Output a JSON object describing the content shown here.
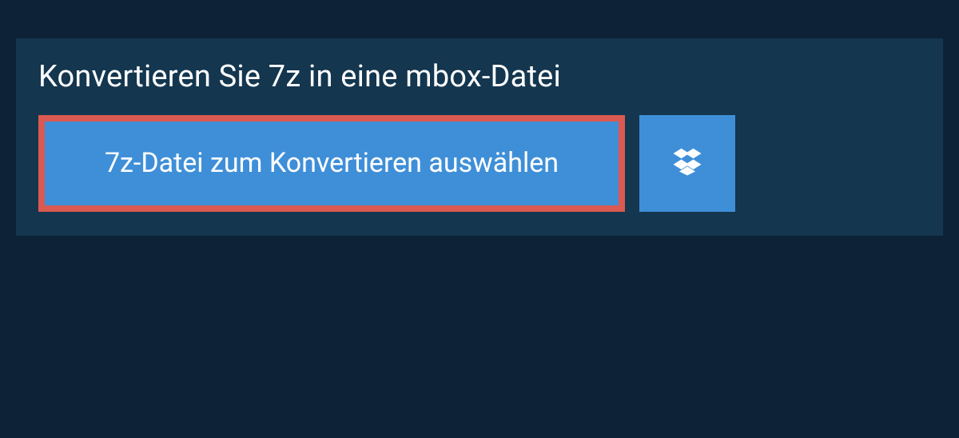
{
  "panel": {
    "title": "Konvertieren Sie 7z in eine mbox-Datei",
    "select_button_label": "7z-Datei zum Konvertieren auswählen"
  },
  "colors": {
    "page_bg": "#0d2236",
    "panel_bg": "#14364f",
    "button_bg": "#3f8fd8",
    "highlight_border": "#da5a52",
    "text": "#ffffff"
  }
}
